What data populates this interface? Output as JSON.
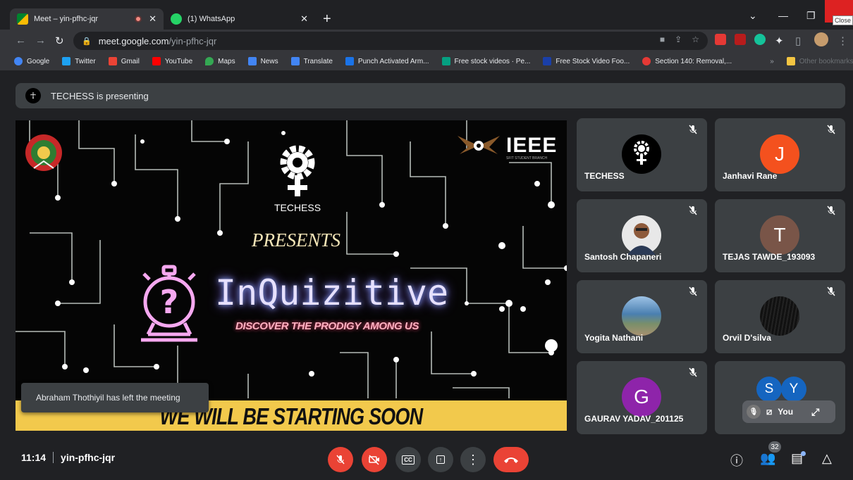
{
  "browser": {
    "tabs": [
      {
        "title": "Meet – yin-pfhc-jqr",
        "active": true
      },
      {
        "title": "(1) WhatsApp",
        "active": false
      }
    ],
    "close_tooltip": "Close",
    "url_host": "meet.google.com",
    "url_path": "/yin-pfhc-jqr",
    "bookmarks": [
      {
        "label": "Google",
        "color": "#4285f4"
      },
      {
        "label": "Twitter",
        "color": "#1da1f2"
      },
      {
        "label": "Gmail",
        "color": "#ea4335"
      },
      {
        "label": "YouTube",
        "color": "#ff0000"
      },
      {
        "label": "Maps",
        "color": "#34a853"
      },
      {
        "label": "News",
        "color": "#4285f4"
      },
      {
        "label": "Translate",
        "color": "#4285f4"
      },
      {
        "label": "Punch Activated Arm...",
        "color": "#1a73e8"
      },
      {
        "label": "Free stock videos · Pe...",
        "color": "#05a081"
      },
      {
        "label": "Free Stock Video Foo...",
        "color": "#1a3fa8"
      },
      {
        "label": "Section 140: Removal,...",
        "color": "#e53935"
      }
    ],
    "other_bookmarks": "Other bookmarks"
  },
  "meet": {
    "presenter_banner": "TECHESS is presenting",
    "slide": {
      "org": "TECHESS",
      "ieee": "IEEE",
      "ieee_sub": "SFIT STUDENT BRANCH",
      "presents": "PRESENTS",
      "event": "InQuizitive",
      "tagline": "DISCOVER THE PRODIGY AMONG US",
      "banner": "WE WILL BE STARTING SOON"
    },
    "toast": "Abraham Thothiyil has left the meeting",
    "participants": [
      {
        "name": "TECHESS",
        "avatar": "logo",
        "avatar_color": "#000000"
      },
      {
        "name": "Janhavi Rane",
        "avatar": "J",
        "avatar_color": "#f4511e"
      },
      {
        "name": "Santosh Chapaneri",
        "avatar": "photo",
        "avatar_color": "#d8d8d8"
      },
      {
        "name": "TEJAS TAWDE_193093",
        "avatar": "T",
        "avatar_color": "#795548"
      },
      {
        "name": "Yogita Nathani",
        "avatar": "photo",
        "avatar_color": "#6f8fb0"
      },
      {
        "name": "Orvil D'silva",
        "avatar": "photo",
        "avatar_color": "#111111"
      },
      {
        "name": "GAURAV YADAV_201125",
        "avatar": "G",
        "avatar_color": "#8e24aa"
      }
    ],
    "self_tile": {
      "initials": [
        "S",
        "Y"
      ],
      "label": "You"
    },
    "time": "11:14",
    "meeting_code": "yin-pfhc-jqr",
    "people_count": "32",
    "colors": {
      "danger": "#ea4335",
      "control_bg": "#3c4043",
      "accent": "#8ab4f8"
    }
  }
}
